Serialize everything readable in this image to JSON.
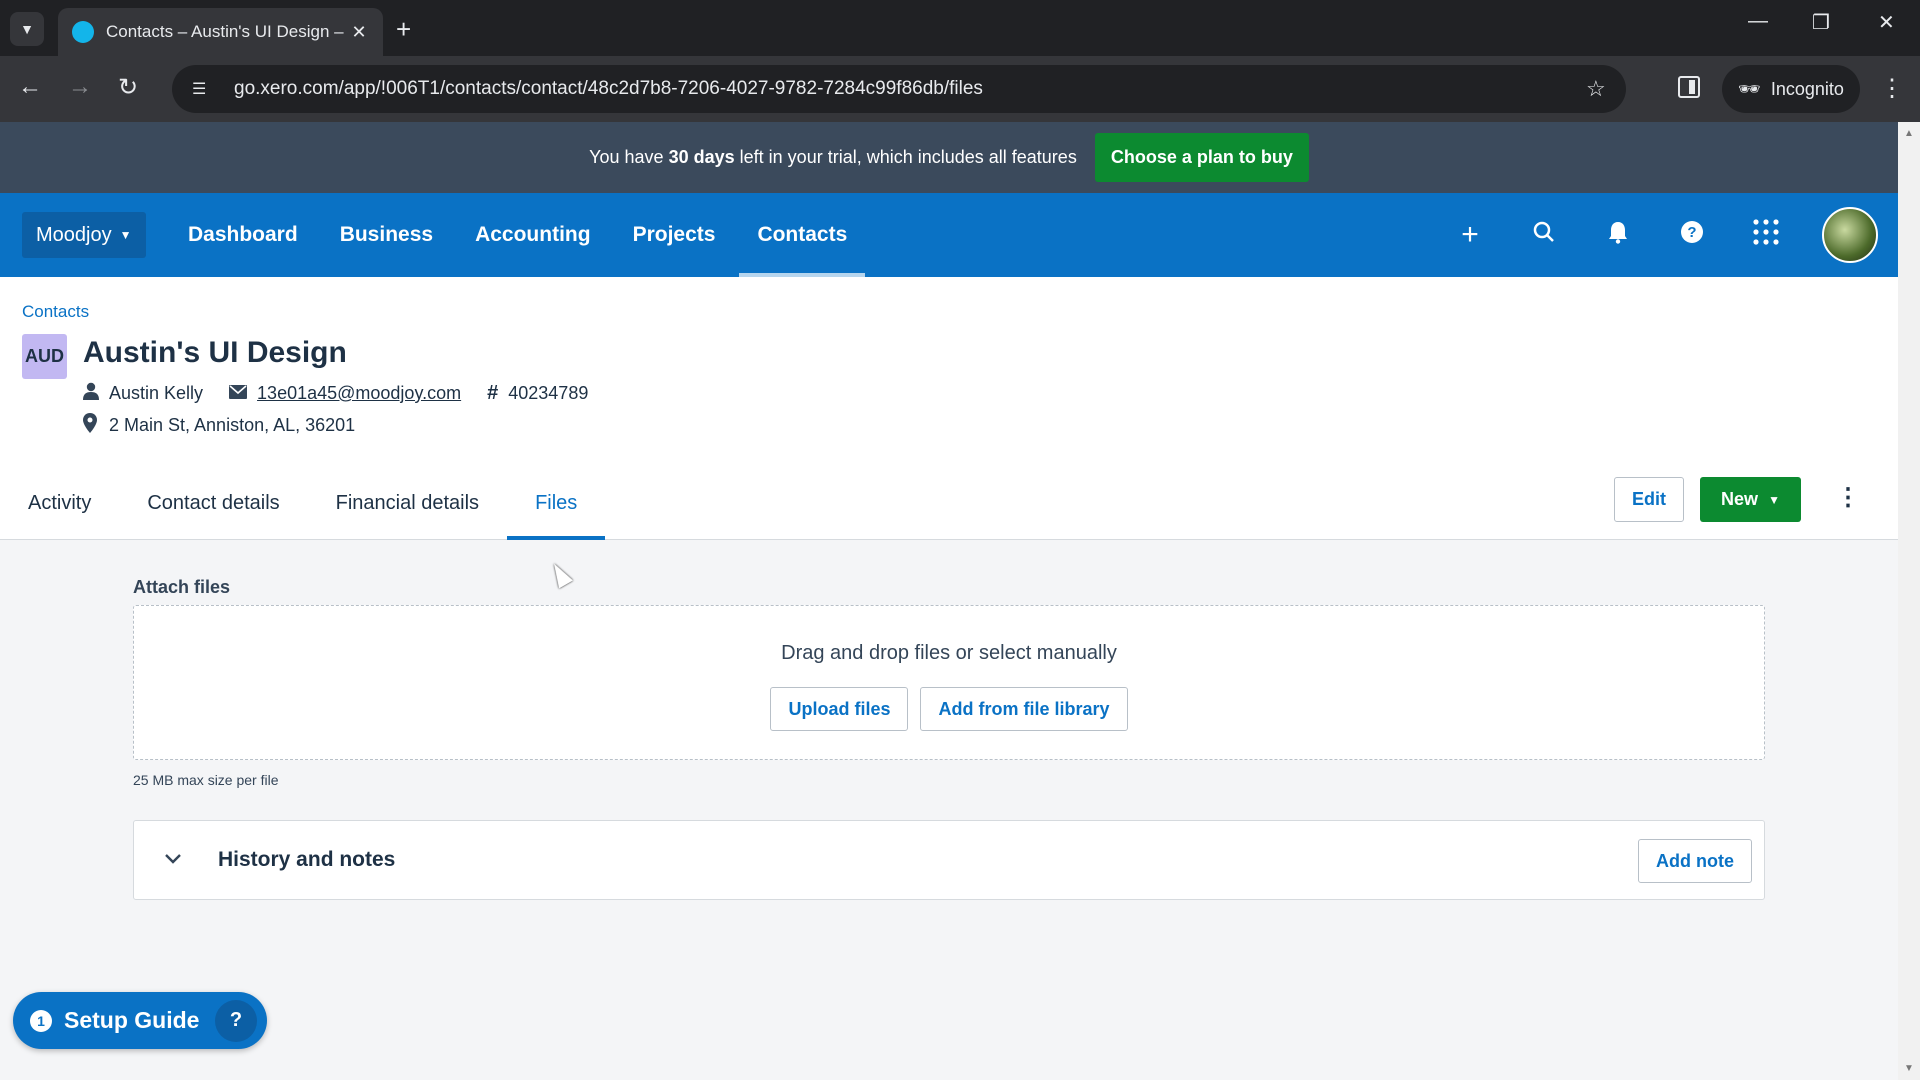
{
  "browser": {
    "tab_title": "Contacts – Austin's UI Design –",
    "url": "go.xero.com/app/!006T1/contacts/contact/48c2d7b8-7206-4027-9782-7284c99f86db/files",
    "incognito_label": "Incognito"
  },
  "trial_banner": {
    "prefix": "You have",
    "days": "30 days",
    "suffix": "left in your trial, which includes all features",
    "cta": "Choose a plan to buy"
  },
  "topnav": {
    "org": "Moodjoy",
    "links": [
      "Dashboard",
      "Business",
      "Accounting",
      "Projects",
      "Contacts"
    ],
    "active": "Contacts"
  },
  "contact": {
    "breadcrumb": "Contacts",
    "badge": "AUD",
    "name": "Austin's UI Design",
    "person": "Austin Kelly",
    "email": "13e01a45@moodjoy.com",
    "number": "40234789",
    "address": "2 Main St, Anniston, AL, 36201"
  },
  "tabs": [
    "Activity",
    "Contact details",
    "Financial details",
    "Files"
  ],
  "actions": {
    "edit": "Edit",
    "new": "New"
  },
  "files": {
    "attach_label": "Attach files",
    "drop_text": "Drag and drop files or select manually",
    "upload": "Upload files",
    "library": "Add from file library",
    "max_size": "25 MB max size per file"
  },
  "history": {
    "title": "History and notes",
    "add_note": "Add note"
  },
  "setup_guide": {
    "count": "1",
    "label": "Setup Guide"
  },
  "colors": {
    "brand_blue": "#0a72c5",
    "green": "#0c8a30",
    "banner": "#3b4a5c"
  }
}
